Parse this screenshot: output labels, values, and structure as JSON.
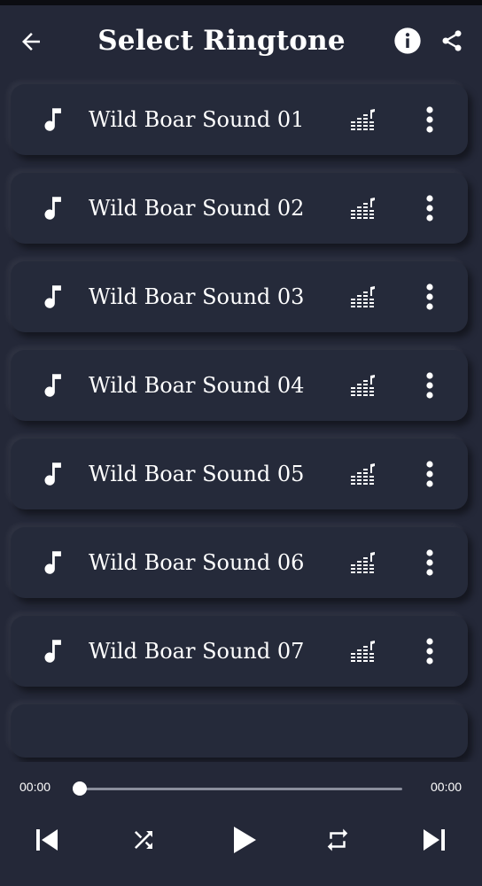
{
  "header": {
    "title": "Select Ringtone",
    "back_icon": "arrow-left-icon",
    "info_icon": "info-icon",
    "share_icon": "share-icon"
  },
  "list": {
    "items": [
      {
        "label": "Wild Boar Sound 01"
      },
      {
        "label": "Wild Boar Sound 02"
      },
      {
        "label": "Wild Boar Sound 03"
      },
      {
        "label": "Wild Boar Sound 04"
      },
      {
        "label": "Wild Boar Sound 05"
      },
      {
        "label": "Wild Boar Sound 06"
      },
      {
        "label": "Wild Boar Sound 07"
      }
    ],
    "item_icon": "music-note-icon",
    "action_icons": [
      "equalizer-icon",
      "more-vertical-icon"
    ]
  },
  "player": {
    "current_time": "00:00",
    "total_time": "00:00",
    "progress": 0,
    "controls": [
      "skip-previous-icon",
      "shuffle-icon",
      "play-icon",
      "repeat-icon",
      "skip-next-icon"
    ]
  },
  "colors": {
    "background": "#242838",
    "card": "#252a3a",
    "text": "#ffffff",
    "track": "#8a8e9c"
  }
}
